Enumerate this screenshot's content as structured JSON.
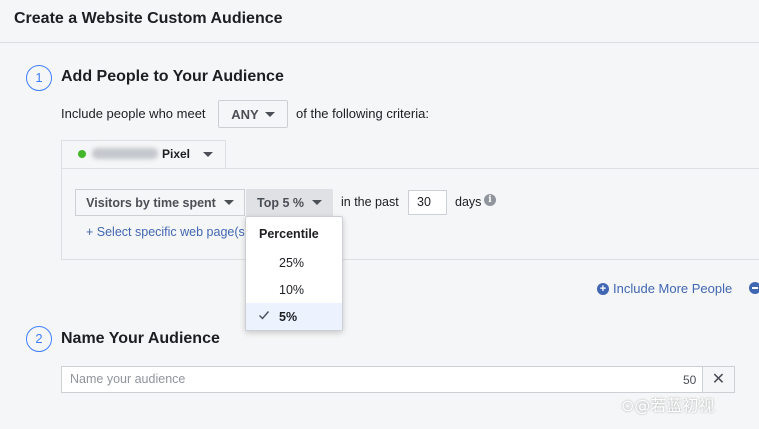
{
  "header": {
    "title": "Create a Website Custom Audience"
  },
  "step1": {
    "number": "1",
    "title": "Add People to Your Audience"
  },
  "criteria": {
    "prefix": "Include people who meet",
    "match": "ANY",
    "suffix": "of the following criteria:"
  },
  "pixel": {
    "name": "Pixel",
    "status_color": "#42b72a"
  },
  "rule": {
    "event": "Visitors by time spent",
    "percentile": "Top 5 %",
    "past_label": "in the past",
    "days_value": "30",
    "days_label": "days",
    "select_pages_link": "+ Select specific web page(s"
  },
  "percentile_menu": {
    "header": "Percentile",
    "options": [
      {
        "label": "25%",
        "selected": false
      },
      {
        "label": "10%",
        "selected": false
      },
      {
        "label": "5%",
        "selected": true
      }
    ]
  },
  "include_more": {
    "label": "Include More People"
  },
  "step2": {
    "number": "2",
    "title": "Name Your Audience"
  },
  "name_field": {
    "placeholder": "Name your audience",
    "value": "",
    "char_limit": "50",
    "clear_symbol": "✕"
  },
  "watermark": {
    "text": "⊙@若蓝初视"
  },
  "colors": {
    "accent": "#4267b2",
    "step_blue": "#4080ff",
    "selected_bg": "#ecf3ff"
  }
}
